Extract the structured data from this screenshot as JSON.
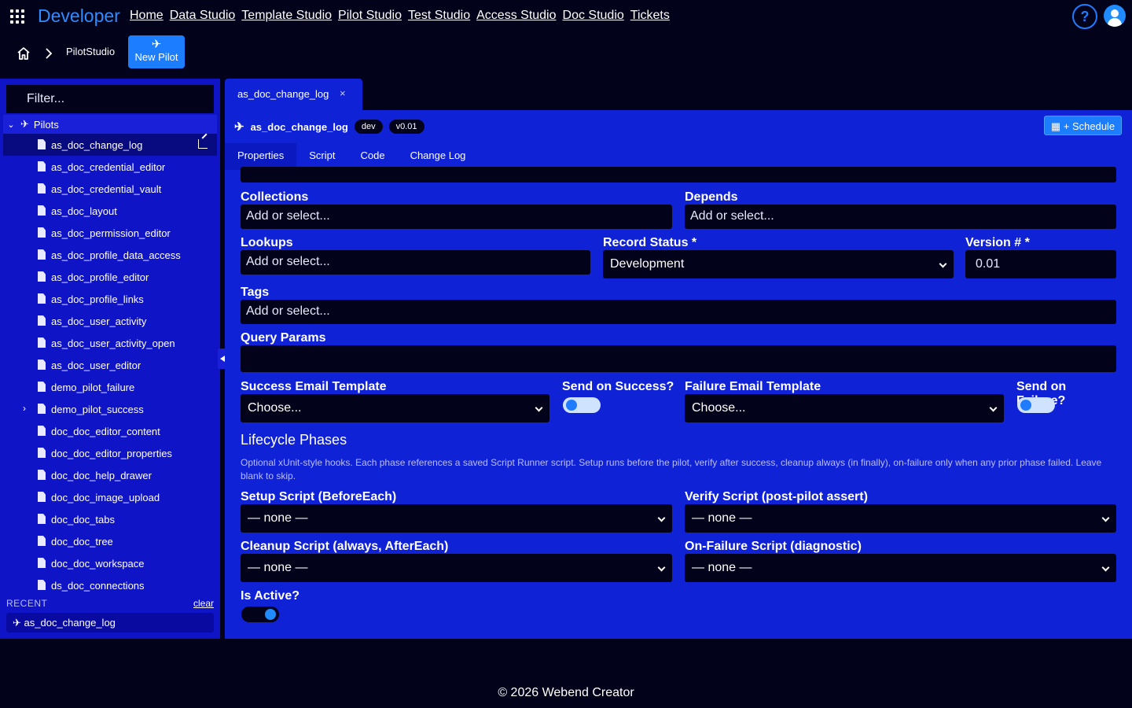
{
  "nav": {
    "brand": "Developer",
    "links": [
      "Home",
      "Data Studio",
      "Template Studio",
      "Pilot Studio",
      "Test Studio",
      "Access Studio",
      "Doc Studio",
      "Tickets"
    ],
    "help": "?"
  },
  "breadcrumb": {
    "current": "PilotStudio",
    "new_pilot_label": "New Pilot"
  },
  "sidebar": {
    "filter_placeholder": "Filter...",
    "group_label": "Pilots",
    "items": [
      "as_doc_change_log",
      "as_doc_credential_editor",
      "as_doc_credential_vault",
      "as_doc_layout",
      "as_doc_permission_editor",
      "as_doc_profile_data_access",
      "as_doc_profile_editor",
      "as_doc_profile_links",
      "as_doc_user_activity",
      "as_doc_user_activity_open",
      "as_doc_user_editor",
      "demo_pilot_failure",
      "demo_pilot_success",
      "doc_doc_editor_content",
      "doc_doc_editor_properties",
      "doc_doc_help_drawer",
      "doc_doc_image_upload",
      "doc_doc_tabs",
      "doc_doc_tree",
      "doc_doc_workspace",
      "ds_doc_connections"
    ],
    "recent_label": "RECENT",
    "clear_label": "clear",
    "recent_items": [
      "as_doc_change_log"
    ]
  },
  "open_tab": {
    "label": "as_doc_change_log",
    "close": "×"
  },
  "pilot": {
    "name": "as_doc_change_log",
    "env_badge": "dev",
    "version_badge": "v0.01",
    "schedule_label": "+ Schedule"
  },
  "tabs": [
    "Properties",
    "Script",
    "Code",
    "Change Log"
  ],
  "form": {
    "collections_label": "Collections",
    "collections_placeholder": "Add or select...",
    "depends_label": "Depends",
    "depends_placeholder": "Add or select...",
    "lookups_label": "Lookups",
    "lookups_placeholder": "Add or select...",
    "record_status_label": "Record Status *",
    "record_status_value": "Development",
    "version_label": "Version # *",
    "version_value": "0.01",
    "tags_label": "Tags",
    "tags_placeholder": "Add or select...",
    "query_params_label": "Query Params",
    "success_template_label": "Success Email Template",
    "success_template_value": "Choose...",
    "send_on_success_label": "Send on Success?",
    "failure_template_label": "Failure Email Template",
    "failure_template_value": "Choose...",
    "send_on_failure_label": "Send on Failure?",
    "lifecycle_title": "Lifecycle Phases",
    "lifecycle_help": "Optional xUnit-style hooks. Each phase references a saved Script Runner script. Setup runs before the pilot, verify after success, cleanup always (in finally), on-failure only when any prior phase failed. Leave blank to skip.",
    "setup_label": "Setup Script (BeforeEach)",
    "setup_value": "— none —",
    "verify_label": "Verify Script (post-pilot assert)",
    "verify_value": "— none —",
    "cleanup_label": "Cleanup Script (always, AfterEach)",
    "cleanup_value": "— none —",
    "onfailure_label": "On-Failure Script (diagnostic)",
    "onfailure_value": "— none —",
    "is_active_label": "Is Active?"
  },
  "toggles": {
    "send_on_success": false,
    "send_on_failure": false,
    "is_active": true
  },
  "footer": "© 2026 Webend Creator",
  "colors": {
    "background": "#02021a",
    "panel": "#1022d6",
    "sidebar": "#0f14c7",
    "accent": "#1c7dff"
  }
}
